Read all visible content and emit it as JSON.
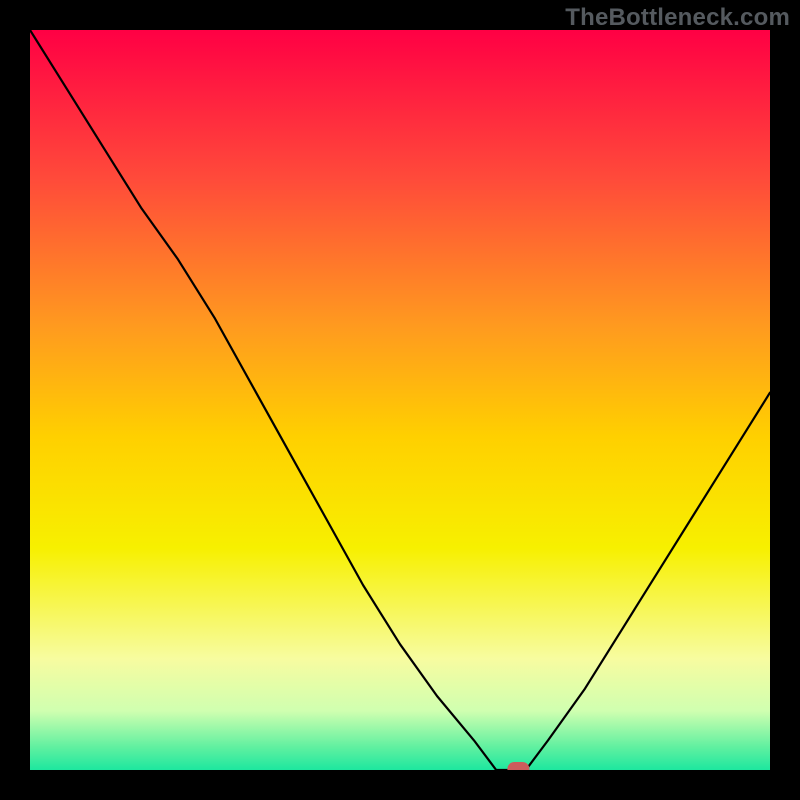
{
  "watermark": "TheBottleneck.com",
  "chart_data": {
    "type": "line",
    "title": "",
    "xlabel": "",
    "ylabel": "",
    "xlim": [
      0,
      100
    ],
    "ylim": [
      0,
      100
    ],
    "grid": false,
    "legend": false,
    "x": [
      0,
      5,
      10,
      15,
      20,
      25,
      30,
      35,
      40,
      45,
      50,
      55,
      60,
      63,
      65,
      67,
      70,
      75,
      80,
      85,
      90,
      95,
      100
    ],
    "values": [
      100,
      92,
      84,
      76,
      69,
      61,
      52,
      43,
      34,
      25,
      17,
      10,
      4,
      0,
      0,
      0,
      4,
      11,
      19,
      27,
      35,
      43,
      51
    ],
    "marker": {
      "x": 66,
      "y": 0,
      "shape": "rounded-rect",
      "color": "#cd5c5c"
    },
    "background_gradient": {
      "stops": [
        {
          "pos": 0.0,
          "color": "#ff0044"
        },
        {
          "pos": 0.2,
          "color": "#ff4a3a"
        },
        {
          "pos": 0.4,
          "color": "#ff9a1f"
        },
        {
          "pos": 0.55,
          "color": "#ffd000"
        },
        {
          "pos": 0.7,
          "color": "#f7f000"
        },
        {
          "pos": 0.85,
          "color": "#f7fca0"
        },
        {
          "pos": 0.92,
          "color": "#d0ffb0"
        },
        {
          "pos": 0.97,
          "color": "#5ef0a0"
        },
        {
          "pos": 1.0,
          "color": "#1de79f"
        }
      ]
    }
  }
}
